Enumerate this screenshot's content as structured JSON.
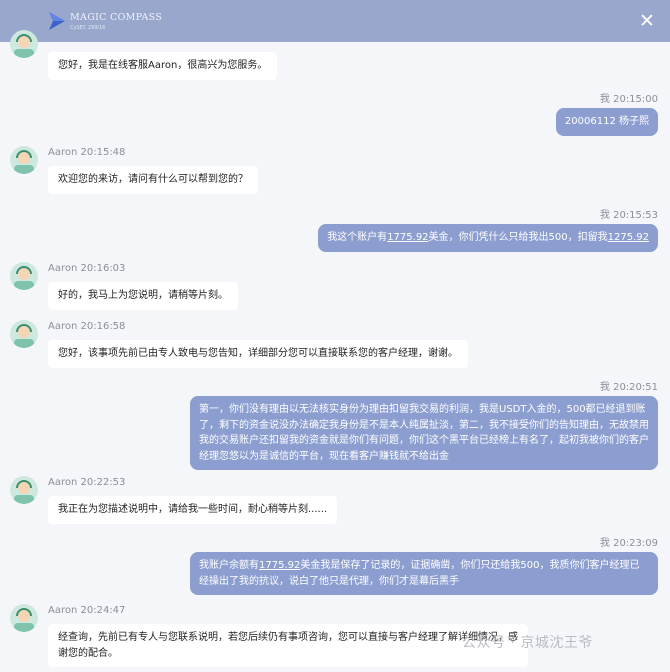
{
  "header": {
    "brand": "MAGIC COMPASS",
    "brand_sub": "CySEC 299/16",
    "close_label": "✕"
  },
  "messages": [
    {
      "sender": "agent",
      "meta": "",
      "text": "您好，我是在线客服Aaron，很高兴为您服务。"
    },
    {
      "sender": "user",
      "meta": "我 20:15:00",
      "text": "20006112 杨子熙"
    },
    {
      "sender": "agent",
      "meta": "Aaron 20:15:48",
      "text": "欢迎您的来访，请问有什么可以帮到您的？"
    },
    {
      "sender": "user",
      "meta": "我 20:15:53",
      "text_a": "我这个账户有",
      "amount_a": "1775.92",
      "text_b": "美金，你们凭什么只给我出500，扣留我",
      "amount_b": "1275.92"
    },
    {
      "sender": "agent",
      "meta": "Aaron 20:16:03",
      "text": "好的，我马上为您说明，请稍等片刻。"
    },
    {
      "sender": "agent",
      "meta": "Aaron 20:16:58",
      "text": "您好，该事项先前已由专人致电与您告知，详细部分您可以直接联系您的客户经理，谢谢。"
    },
    {
      "sender": "user",
      "meta": "我 20:20:51",
      "text": "第一，你们没有理由以无法核实身份为理由扣留我交易的利润，我是USDT入金的，500都已经退到账了，剩下的资金说没办法确定我身份是不是本人纯属扯淡，第二，我不接受你们的告知理由，无故禁用我的交易账户还扣留我的资金就是你们有问题，你们这个黑平台已经榜上有名了，起初我被你们的客户经理忽悠以为是诚信的平台，现在看客户赚钱就不给出金"
    },
    {
      "sender": "agent",
      "meta": "Aaron 20:22:53",
      "text": "我正在为您描述说明中，请给我一些时间，耐心稍等片刻......"
    },
    {
      "sender": "user",
      "meta": "我 20:23:09",
      "text_a": "我账户余额有",
      "amount_a": "1775.92",
      "text_b": "美金我是保存了记录的，证据确凿，你们只还给我500，我质你们客户经理已经操出了我的抗议，说白了他只是代理，你们才是幕后黑手"
    },
    {
      "sender": "agent",
      "meta": "Aaron 20:24:47",
      "text": "经查询，先前已有专人与您联系说明，若您后续仍有事项咨询，您可以直接与客户经理了解详细情况，感谢您的配合。"
    }
  ],
  "watermark": "公众号 · 京城沈王爷",
  "colors": {
    "header": "#9aa7cc",
    "user_bubble": "#8c9ed0",
    "agent_bubble": "#ffffff",
    "background": "#f4f6fa"
  }
}
